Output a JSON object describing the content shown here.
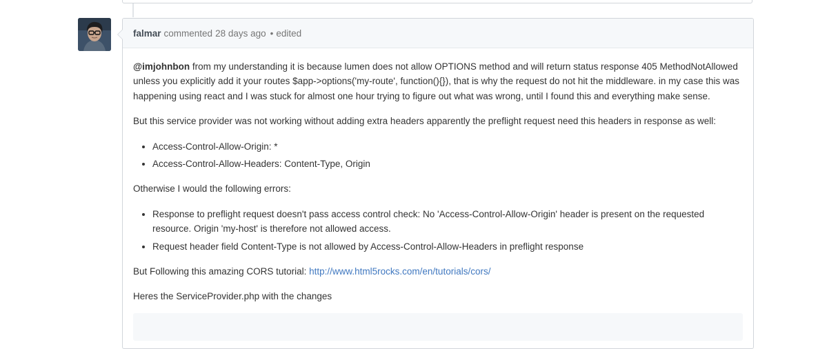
{
  "comment": {
    "author": "falmar",
    "action": "commented",
    "time": "28 days ago",
    "separator": "•",
    "edited": "edited",
    "body": {
      "p1_mention": "@imjohnbon",
      "p1_text": "from my understanding it is because lumen does not allow OPTIONS method and will return status response 405 MethodNotAllowed unless you explicitly add it your routes $app->options('my-route', function(){}), that is why the request do not hit the middleware. in my case this was happening using react and I was stuck for almost one hour trying to figure out what was wrong, until I found this and everything make sense.",
      "p2": "But this service provider was not working without adding extra headers apparently the preflight request need this headers in response as well:",
      "list1": [
        "Access-Control-Allow-Origin: *",
        "Access-Control-Allow-Headers: Content-Type, Origin"
      ],
      "p3": "Otherwise I would the following errors:",
      "list2": [
        "Response to preflight request doesn't pass access control check: No 'Access-Control-Allow-Origin' header is present on the requested resource. Origin 'my-host' is therefore not allowed access.",
        "Request header field Content-Type is not allowed by Access-Control-Allow-Headers in preflight response"
      ],
      "p4_text": "But Following this amazing CORS tutorial:",
      "p4_link": "http://www.html5rocks.com/en/tutorials/cors/",
      "p5": "Heres the ServiceProvider.php with the changes"
    }
  },
  "colors": {
    "link": "#4078c0",
    "header_bg": "#f6f8fa",
    "border": "#d1d5da"
  }
}
